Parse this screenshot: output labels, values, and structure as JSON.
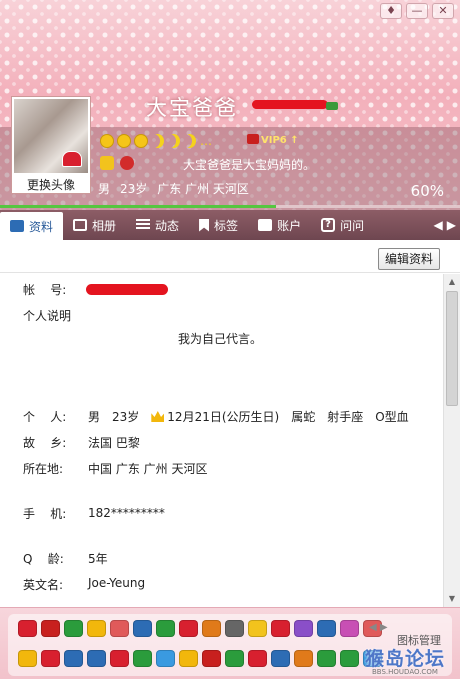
{
  "window": {
    "buttons": [
      {
        "name": "skin-button",
        "glyph": "♦"
      },
      {
        "name": "minimize-button",
        "glyph": "—"
      },
      {
        "name": "close-button",
        "glyph": "✕"
      }
    ]
  },
  "profile": {
    "nickname": "大宝爸爸",
    "change_avatar": "更换头像",
    "vip_label": "VIP6 ↑",
    "level_badges": [
      "sun",
      "sun",
      "sun",
      "moon",
      "moon",
      "moon"
    ],
    "level_more": "…",
    "signature": "大宝爸爸是大宝妈妈的。",
    "basic": [
      "男",
      "23岁",
      "广东 广州 天河区"
    ],
    "completion_text": "60%",
    "completion": 0.6
  },
  "tabs": [
    {
      "label": "资料",
      "icon": "card-icon",
      "active": true
    },
    {
      "label": "相册",
      "icon": "photo-icon"
    },
    {
      "label": "动态",
      "icon": "list-icon"
    },
    {
      "label": "标签",
      "icon": "tag-icon"
    },
    {
      "label": "账户",
      "icon": "wallet-icon"
    },
    {
      "label": "问问",
      "icon": "question-icon"
    }
  ],
  "tab_nav": {
    "prev": "◀",
    "next": "▶"
  },
  "toolbar": {
    "edit_label": "编辑资料"
  },
  "fields": {
    "account_label": "帐    号:",
    "desc_label": "个人说明",
    "desc_value": "我为自己代言。",
    "personal_label": "个    人:",
    "personal": {
      "gender": "男",
      "age": "23岁",
      "birthday": "12月21日(公历生日)",
      "zodiac": "属蛇",
      "constellation": "射手座",
      "blood": "O型血"
    },
    "hometown_label": "故    乡:",
    "hometown_value": "法国 巴黎",
    "location_label": "所在地:",
    "location_value": "中国 广东 广州 天河区",
    "phone_label": "手    机:",
    "phone_value": "182*********",
    "qage_label": "Q    龄:",
    "qage_value": "5年",
    "english_label": "英文名:",
    "english_value": "Joe-Yeung"
  },
  "tray": {
    "manage_label": "图标管理",
    "nav": "◀ ▶",
    "watermark": "猴岛论坛",
    "watermark_sub": "BBS.HOUDAO.COM",
    "row1_colors": [
      "#d8202f",
      "#c8201e",
      "#2b9c3c",
      "#f2b70c",
      "#e05a5a",
      "#2d6cb4",
      "#2b9c3c",
      "#d8202f",
      "#e07a1a",
      "#666666",
      "#f2c31d",
      "#d8202f",
      "#8a4fc8",
      "#2d6cb4",
      "#c84fb4",
      "#e05a5a"
    ],
    "row2_colors": [
      "#f2b70c",
      "#d8202f",
      "#2d6cb4",
      "#2d6cb4",
      "#d8202f",
      "#2b9c3c",
      "#3a9ae0",
      "#f2b70c",
      "#c8201e",
      "#2b9c3c",
      "#d8202f",
      "#2d6cb4",
      "#e07a1a",
      "#2b9c3c",
      "#2b9c3c",
      "#3a9ae0",
      "#d8202f",
      "#2d6cb4"
    ]
  }
}
